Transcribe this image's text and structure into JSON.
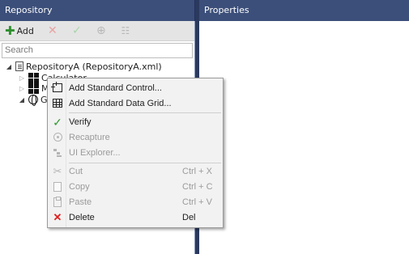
{
  "panes": {
    "repository_title": "Repository",
    "properties_title": "Properties"
  },
  "toolbar": {
    "add_label": "Add",
    "add_icon": "plus-icon",
    "delete_icon": "x-icon",
    "verify_icon": "check-icon",
    "recapture_icon": "target-icon",
    "explorer_icon": "tree-icon"
  },
  "search": {
    "placeholder": "Search"
  },
  "tree": {
    "root_label": "RepositoryA (RepositoryA.xml)",
    "child1_label": "Calculator",
    "child2_label": "M",
    "child3_label": "G"
  },
  "context_menu": {
    "items": [
      {
        "label": "Add Standard Control...",
        "shortcut": "",
        "icon": "add-control-icon",
        "enabled": true
      },
      {
        "label": "Add Standard Data Grid...",
        "shortcut": "",
        "icon": "data-grid-icon",
        "enabled": true
      },
      {
        "label": "Verify",
        "shortcut": "",
        "icon": "check-icon",
        "enabled": true
      },
      {
        "label": "Recapture",
        "shortcut": "",
        "icon": "target-icon",
        "enabled": false
      },
      {
        "label": "UI Explorer...",
        "shortcut": "",
        "icon": "tree-icon",
        "enabled": false
      },
      {
        "label": "Cut",
        "shortcut": "Ctrl + X",
        "icon": "scissors-icon",
        "enabled": false
      },
      {
        "label": "Copy",
        "shortcut": "Ctrl + C",
        "icon": "copy-icon",
        "enabled": false
      },
      {
        "label": "Paste",
        "shortcut": "Ctrl + V",
        "icon": "paste-icon",
        "enabled": false
      },
      {
        "label": "Delete",
        "shortcut": "Del",
        "icon": "x-icon",
        "enabled": true
      }
    ]
  },
  "colors": {
    "header_bg": "#3c4f7a",
    "frame_bg": "#2a3a5e",
    "add_green": "#2f8f2f",
    "delete_red": "#e02020"
  }
}
